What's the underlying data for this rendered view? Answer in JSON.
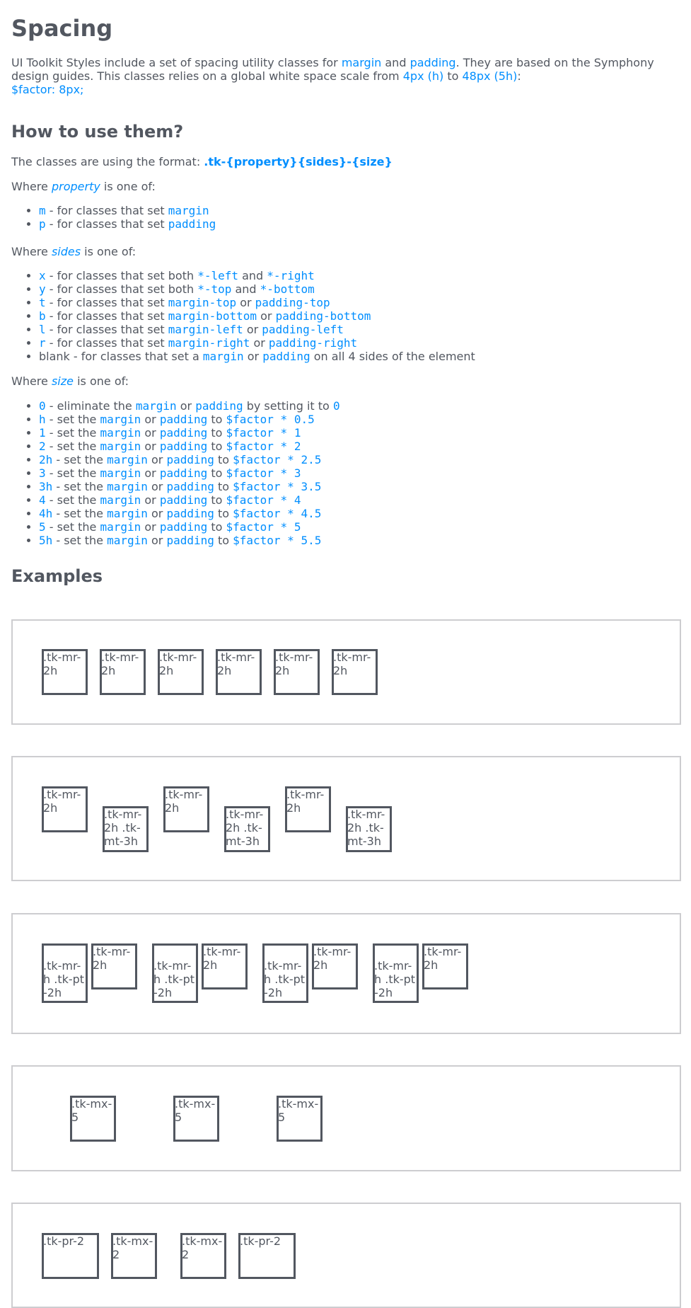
{
  "title": "Spacing",
  "intro": {
    "t1": "UI Toolkit Styles include a set of spacing utility classes for ",
    "margin": "margin",
    "t2": " and ",
    "padding": "padding",
    "t3": ". They are based on the Symphony design guides. This classes relies on a global white space scale from ",
    "min": "4px (h)",
    "t4": " to ",
    "max": "48px (5h)",
    "t5": ":",
    "factor": "$factor: 8px;"
  },
  "how": {
    "heading": "How to use them?",
    "format_prefix": "The classes are using the format: ",
    "format": ".tk-{property}{sides}-{size}",
    "where": "Where ",
    "is_one_of": " is one of:",
    "property_word": "property",
    "sides_word": "sides",
    "size_word": "size"
  },
  "property_items": [
    {
      "code": "m",
      "t1": " - for classes that set ",
      "c1": "margin"
    },
    {
      "code": "p",
      "t1": " - for classes that set ",
      "c1": "padding"
    }
  ],
  "sides_items": [
    {
      "code": "x",
      "t1": " - for classes that set both ",
      "c1": "*-left",
      "t2": " and ",
      "c2": "*-right"
    },
    {
      "code": "y",
      "t1": " - for classes that set both ",
      "c1": "*-top",
      "t2": " and ",
      "c2": "*-bottom"
    },
    {
      "code": "t",
      "t1": " - for classes that set ",
      "c1": "margin-top",
      "t2": " or ",
      "c2": "padding-top"
    },
    {
      "code": "b",
      "t1": " - for classes that set ",
      "c1": "margin-bottom",
      "t2": " or ",
      "c2": "padding-bottom"
    },
    {
      "code": "l",
      "t1": " - for classes that set ",
      "c1": "margin-left",
      "t2": " or ",
      "c2": "padding-left"
    },
    {
      "code": "r",
      "t1": " - for classes that set ",
      "c1": "margin-right",
      "t2": " or ",
      "c2": "padding-right"
    }
  ],
  "sides_blank": {
    "t0": "blank - for classes that set a ",
    "c1": "margin",
    "t1": " or ",
    "c2": "padding",
    "t2": " on all 4 sides of the element"
  },
  "size_zero": {
    "code": "0",
    "t1": " - eliminate the ",
    "c1": "margin",
    "t2": " or ",
    "c2": "padding",
    "t3": " by setting it to ",
    "c3": "0"
  },
  "size_items": [
    {
      "code": "h",
      "f": "$factor * 0.5"
    },
    {
      "code": "1",
      "f": "$factor * 1"
    },
    {
      "code": "2",
      "f": "$factor * 2"
    },
    {
      "code": "2h",
      "f": "$factor * 2.5"
    },
    {
      "code": "3",
      "f": "$factor * 3"
    },
    {
      "code": "3h",
      "f": "$factor * 3.5"
    },
    {
      "code": "4",
      "f": "$factor * 4"
    },
    {
      "code": "4h",
      "f": "$factor * 4.5"
    },
    {
      "code": "5",
      "f": "$factor * 5"
    },
    {
      "code": "5h",
      "f": "$factor * 5.5"
    }
  ],
  "size_text": {
    "t1": " - set the ",
    "c1": "margin",
    "t2": " or ",
    "c2": "padding",
    "t3": " to "
  },
  "examples": {
    "heading": "Examples",
    "ex1": [
      ".tk-mr-2h",
      ".tk-mr-2h",
      ".tk-mr-2h",
      ".tk-mr-2h",
      ".tk-mr-2h",
      ".tk-mr-2h"
    ],
    "ex2": [
      ".tk-mr-2h",
      ".tk-mr-2h .tk-mt-3h",
      ".tk-mr-2h",
      ".tk-mr-2h .tk-mt-3h",
      ".tk-mr-2h",
      ".tk-mr-2h .tk-mt-3h"
    ],
    "ex3": [
      ".tk-mr-h .tk-pt-2h",
      ".tk-mr-2h",
      ".tk-mr-h .tk-pt-2h",
      ".tk-mr-2h",
      ".tk-mr-h .tk-pt-2h",
      ".tk-mr-2h",
      ".tk-mr-h .tk-pt-2h",
      ".tk-mr-2h"
    ],
    "ex4": [
      ".tk-mx-5",
      ".tk-mx-5",
      ".tk-mx-5"
    ],
    "ex5": [
      ".tk-pr-2",
      ".tk-mx-2",
      ".tk-mx-2",
      ".tk-pr-2"
    ]
  },
  "colors": {
    "text": "#525760",
    "accent": "#008eff",
    "border": "#cdcdd0"
  }
}
